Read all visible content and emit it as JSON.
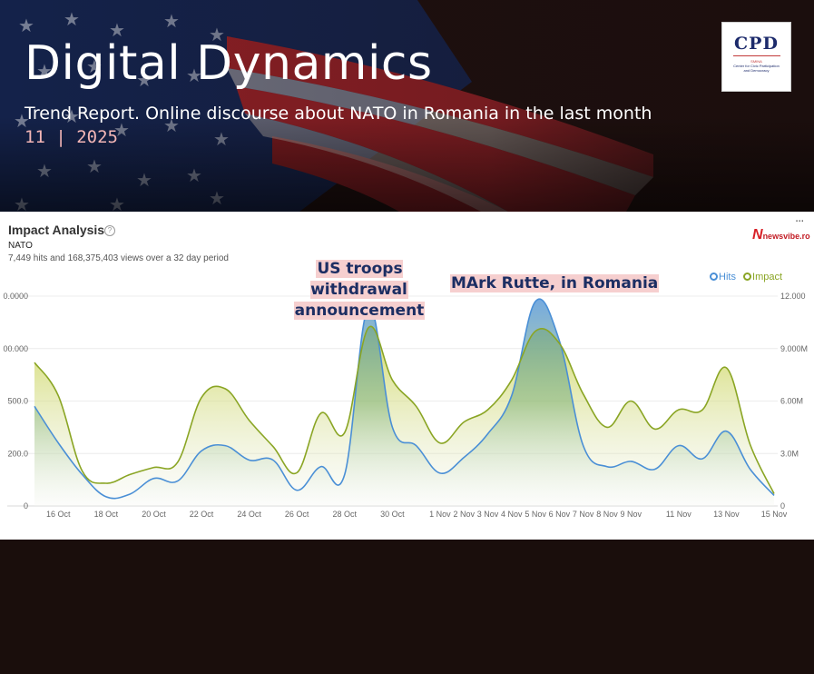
{
  "header": {
    "title": "Digital Dynamics",
    "subtitle": "Trend Report. Online discourse about NATO in Romania in the last month",
    "edition": "11 | 2025"
  },
  "logo": {
    "mark": "CPD",
    "small_top": "SMINA",
    "small_line1": "Center for Civic Participation",
    "small_line2": "and Democracy"
  },
  "panel": {
    "title": "Impact Analysis",
    "help_icon": "?",
    "keyword": "NATO",
    "stats": "7,449 hits and 168,375,403 views over a 32 day period",
    "more_icon": "···",
    "brand_letter": "N",
    "brand_text": "newsvibe.ro"
  },
  "annotations": {
    "first_line1": "US troops withdrawal",
    "first_line2": "announcement",
    "second": "MArk Rutte, in Romania"
  },
  "colors": {
    "hits": "#4a8fd6",
    "impact": "#8aa524",
    "highlight": "#f6cfcf",
    "annotation_text": "#1c2e63"
  },
  "chart_data": {
    "type": "area",
    "x": [
      "15 Oct",
      "16 Oct",
      "17 Oct",
      "18 Oct",
      "19 Oct",
      "20 Oct",
      "21 Oct",
      "22 Oct",
      "23 Oct",
      "24 Oct",
      "25 Oct",
      "26 Oct",
      "27 Oct",
      "28 Oct",
      "29 Oct",
      "30 Oct",
      "31 Oct",
      "1 Nov",
      "2 Nov",
      "3 Nov",
      "4 Nov",
      "5 Nov",
      "6 Nov",
      "7 Nov",
      "8 Nov",
      "9 Nov",
      "10 Nov",
      "11 Nov",
      "12 Nov",
      "13 Nov",
      "14 Nov",
      "15 Nov"
    ],
    "x_tick_labels": [
      "16 Oct",
      "18 Oct",
      "20 Oct",
      "22 Oct",
      "24 Oct",
      "26 Oct",
      "28 Oct",
      "30 Oct",
      "1 Nov",
      "2 Nov",
      "3 Nov",
      "4 Nov",
      "5 Nov",
      "6 Nov",
      "7 Nov",
      "8 Nov",
      "9 Nov",
      "11 Nov",
      "13 Nov",
      "15 Nov"
    ],
    "left_axis_ticks": [
      "0",
      "200.0",
      "500.0",
      "00.000",
      "0.0000"
    ],
    "right_axis_ticks": [
      "0",
      "3.0M",
      "6.00M",
      "9.000M",
      "12.000"
    ],
    "left_ylim": [
      0,
      800
    ],
    "right_ylim": [
      0,
      12000000
    ],
    "series": [
      {
        "name": "Hits",
        "axis": "left",
        "values": [
          380,
          240,
          120,
          35,
          45,
          105,
          95,
          210,
          230,
          175,
          175,
          60,
          150,
          120,
          760,
          300,
          230,
          125,
          185,
          275,
          420,
          780,
          630,
          230,
          150,
          170,
          140,
          230,
          180,
          285,
          140,
          40
        ]
      },
      {
        "name": "Impact",
        "axis": "right",
        "values": [
          8200000,
          6300000,
          2000000,
          1300000,
          1800000,
          2200000,
          2500000,
          6200000,
          6700000,
          4900000,
          3400000,
          1900000,
          5300000,
          4200000,
          10200000,
          7200000,
          5700000,
          3600000,
          4800000,
          5500000,
          7200000,
          10000000,
          9300000,
          6400000,
          4500000,
          6000000,
          4400000,
          5500000,
          5500000,
          7900000,
          3500000,
          700000
        ]
      }
    ],
    "legend_position": "top-right",
    "grid": true
  }
}
